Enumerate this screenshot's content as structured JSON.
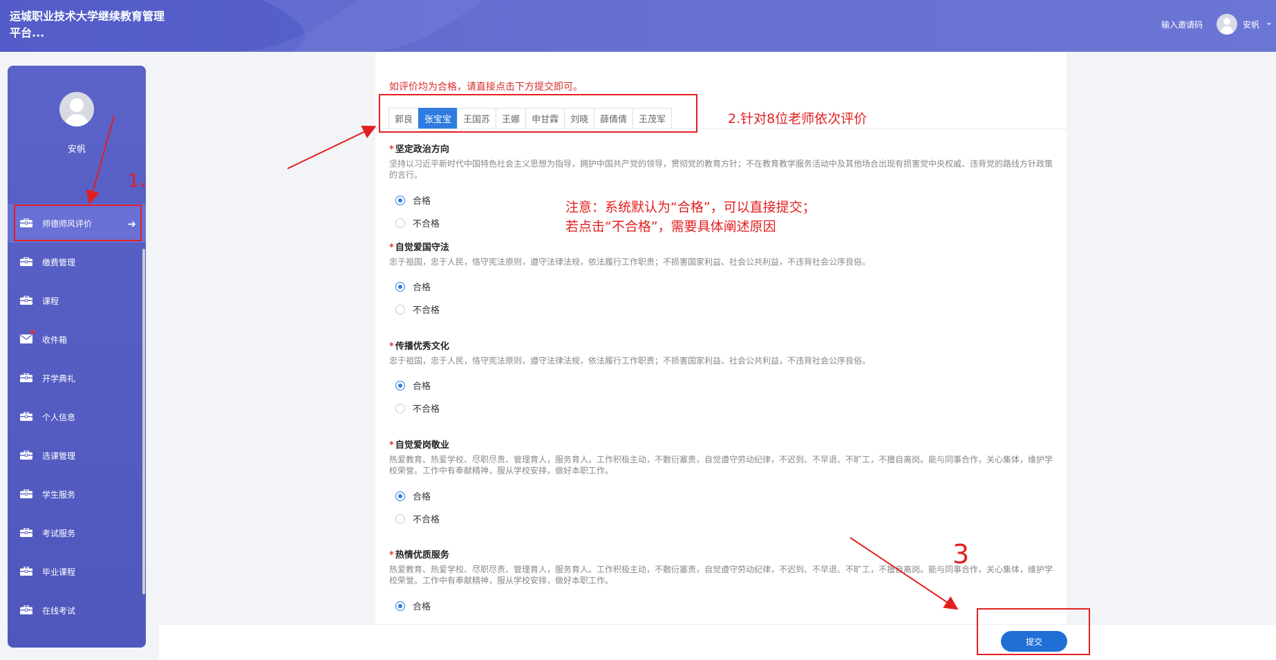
{
  "header": {
    "brand": "运城职业技术大学继续教育管理平台...",
    "invite_label": "输入邀请码",
    "user_name": "安帆",
    "user_caret": "⌄"
  },
  "sidebar": {
    "user_name": "安帆",
    "items": [
      {
        "label": "师德师风评价",
        "active": true,
        "icon": "briefcase-icon",
        "arrow": "➜"
      },
      {
        "label": "缴费管理",
        "icon": "briefcase-icon"
      },
      {
        "label": "课程",
        "icon": "briefcase-icon"
      },
      {
        "label": "收件箱",
        "icon": "envelope-icon",
        "badge_dot": true
      },
      {
        "label": "开学典礼",
        "icon": "briefcase-icon"
      },
      {
        "label": "个人信息",
        "icon": "briefcase-icon"
      },
      {
        "label": "选课管理",
        "icon": "briefcase-icon"
      },
      {
        "label": "学生服务",
        "icon": "briefcase-icon"
      },
      {
        "label": "考试服务",
        "icon": "briefcase-icon"
      },
      {
        "label": "毕业课程",
        "icon": "briefcase-icon"
      },
      {
        "label": "在线考试",
        "icon": "briefcase-icon"
      }
    ]
  },
  "main": {
    "notice": "如评价均为合格，请直接点击下方提交即可。",
    "tabs": [
      "郭良",
      "张宝宝",
      "王国苏",
      "王娜",
      "申甘霖",
      "刘晓",
      "薛倩倩",
      "王茂军"
    ],
    "active_tab": "张宝宝",
    "required_mark": "*",
    "questions": [
      {
        "title": "坚定政治方向",
        "desc": "坚持以习近平新时代中国特色社会主义思想为指导，拥护中国共产党的领导，贯彻党的教育方针；不在教育教学服务活动中及其他场合出现有损害党中央权威、违背党的路线方针政策的言行。",
        "options": [
          "合格",
          "不合格"
        ],
        "selected": "合格"
      },
      {
        "title": "自觉爱国守法",
        "desc": "忠于祖国，忠于人民，恪守宪法原则，遵守法律法规，依法履行工作职责；不损害国家利益、社会公共利益，不违背社会公序良俗。",
        "options": [
          "合格",
          "不合格"
        ],
        "selected": "合格"
      },
      {
        "title": "传播优秀文化",
        "desc": "忠于祖国，忠于人民，恪守宪法原则，遵守法律法规，依法履行工作职责；不损害国家利益、社会公共利益，不违背社会公序良俗。",
        "options": [
          "合格",
          "不合格"
        ],
        "selected": "合格"
      },
      {
        "title": "自觉爱岗敬业",
        "desc": "热爱教育、热爱学校、尽职尽责、管理育人，服务育人。工作积极主动，不敷衍塞责，自觉遵守劳动纪律，不迟到、不早退、不旷工，不擅自离岗。能与同事合作，关心集体，维护学校荣誉。工作中有奉献精神，服从学校安排，做好本职工作。",
        "options": [
          "合格",
          "不合格"
        ],
        "selected": "合格"
      },
      {
        "title": "热情优质服务",
        "desc": "热爱教育、热爱学校、尽职尽责、管理育人，服务育人。工作积极主动，不敷衍塞责，自觉遵守劳动纪律，不迟到、不早退、不旷工，不擅自离岗。能与同事合作，关心集体，维护学校荣誉。工作中有奉献精神，服从学校安排，做好本职工作。",
        "options": [
          "合格"
        ],
        "selected": "合格"
      }
    ],
    "submit_label": "提交"
  },
  "annotations": {
    "step1": "1、",
    "step2": "2.针对8位老师依次评价",
    "note_line1": "注意：系统默认为“合格”，可以直接提交；",
    "note_line2": "若点击“不合格”，需要具体阐述原因",
    "step3": "3",
    "color": "#e21f1f"
  },
  "colors": {
    "header": "#6670d0",
    "sidebar": "#5159c0",
    "primary": "#2f7ce0",
    "notice": "#d82b2b"
  }
}
